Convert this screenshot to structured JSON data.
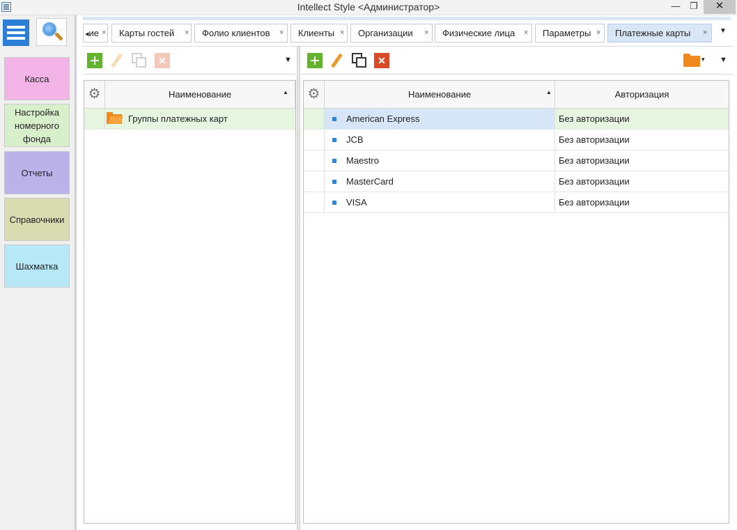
{
  "window": {
    "title": "Intellect Style  <Администратор>",
    "buttons": {
      "minimize": "—",
      "maximize": "❐",
      "close": "✕"
    }
  },
  "sidebar": {
    "menu_icon": "hamburger-icon",
    "search_icon": "magnifier-icon",
    "items": [
      {
        "label": "Касса",
        "color": "#f2b3e6"
      },
      {
        "label": "Настройка номерного фонда",
        "color": "#d8efcc"
      },
      {
        "label": "Отчеты",
        "color": "#bcb2ea"
      },
      {
        "label": "Справочники",
        "color": "#d9dbb0"
      },
      {
        "label": "Шахматка",
        "color": "#b7e8f7"
      }
    ]
  },
  "tabs": {
    "items": [
      {
        "label": "ие",
        "active": false
      },
      {
        "label": "Карты гостей",
        "active": false
      },
      {
        "label": "Фолио клиентов",
        "active": false
      },
      {
        "label": "Клиенты",
        "active": false
      },
      {
        "label": "Организации",
        "active": false
      },
      {
        "label": "Физические лица",
        "active": false
      },
      {
        "label": "Параметры",
        "active": false
      },
      {
        "label": "Платежные карты",
        "active": true
      }
    ],
    "close_glyph": "×",
    "overflow_glyph": "▼",
    "scroll_left_glyph": "◂"
  },
  "left_panel": {
    "toolbar": {
      "dropdown_glyph": "▼"
    },
    "columns": [
      "Наименование"
    ],
    "sort_glyph": "▲",
    "gear_glyph": "⚙",
    "rows": [
      {
        "name": "Группы платежных карт"
      }
    ]
  },
  "right_panel": {
    "toolbar": {
      "dropdown_glyph": "▼",
      "folder_dropdown_glyph": "▾"
    },
    "columns": [
      "Наименование",
      "Авторизация"
    ],
    "sort_glyph": "▲",
    "gear_glyph": "⚙",
    "rows": [
      {
        "name": "American Express",
        "auth": "Без авторизации"
      },
      {
        "name": "JCB",
        "auth": "Без авторизации"
      },
      {
        "name": "Maestro",
        "auth": "Без авторизации"
      },
      {
        "name": "MasterCard",
        "auth": "Без авторизации"
      },
      {
        "name": "VISA",
        "auth": "Без авторизации"
      }
    ]
  },
  "colors": {
    "row_highlight": "#e6f5e0",
    "selected_cell": "#d6e6f8",
    "accent_blue": "#2b7fd6",
    "add_green": "#64b32e",
    "delete_red": "#d84b25"
  }
}
